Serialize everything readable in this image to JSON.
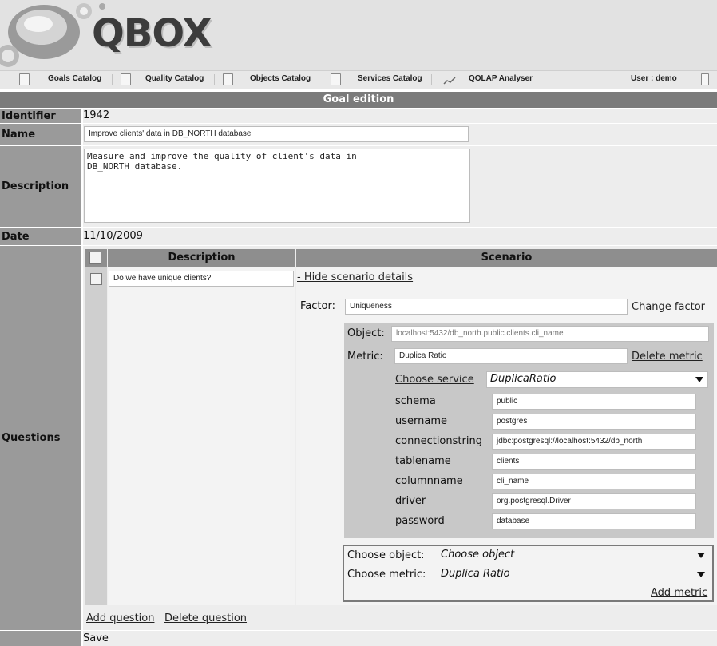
{
  "app": {
    "logo": "QBOX"
  },
  "toolbar": {
    "items": [
      "Goals Catalog",
      "Quality Catalog",
      "Objects Catalog",
      "Services Catalog",
      "QOLAP Analyser"
    ],
    "user": "User : demo"
  },
  "page": {
    "title": "Goal edition"
  },
  "form": {
    "identifier_label": "Identifier",
    "identifier_value": "1942",
    "name_label": "Name",
    "name_value": "Improve clients' data in DB_NORTH database",
    "description_label": "Description",
    "description_value": "Measure and improve the quality of client's data in\nDB_NORTH database.",
    "date_label": "Date",
    "date_value": "11/10/2009",
    "questions_label": "Questions"
  },
  "questions": {
    "col_description": "Description",
    "col_scenario": "Scenario",
    "items": [
      {
        "description": "Do we have unique clients?"
      }
    ],
    "add_question": "Add question",
    "delete_question": "Delete question",
    "save": "Save"
  },
  "scenario": {
    "hide_link": "- Hide scenario details",
    "factor_label": "Factor:",
    "factor_value": "Uniqueness",
    "change_factor": "Change factor",
    "object_label": "Object:",
    "object_value": "localhost:5432/db_north.public.clients.cli_name",
    "metric_label": "Metric:",
    "metric_value": "Duplica Ratio",
    "delete_metric": "Delete metric",
    "choose_service": "Choose service",
    "service_value": "DuplicaRatio",
    "params": [
      {
        "name": "schema",
        "value": "public"
      },
      {
        "name": "username",
        "value": "postgres"
      },
      {
        "name": "connectionstring",
        "value": "jdbc:postgresql://localhost:5432/db_north"
      },
      {
        "name": "tablename",
        "value": "clients"
      },
      {
        "name": "columnname",
        "value": "cli_name"
      },
      {
        "name": "driver",
        "value": "org.postgresql.Driver"
      },
      {
        "name": "password",
        "value": "database"
      }
    ],
    "choose_object_label": "Choose object:",
    "choose_object_value": "Choose object",
    "choose_metric_label": "Choose metric:",
    "choose_metric_value": "Duplica Ratio",
    "add_metric": "Add metric"
  }
}
